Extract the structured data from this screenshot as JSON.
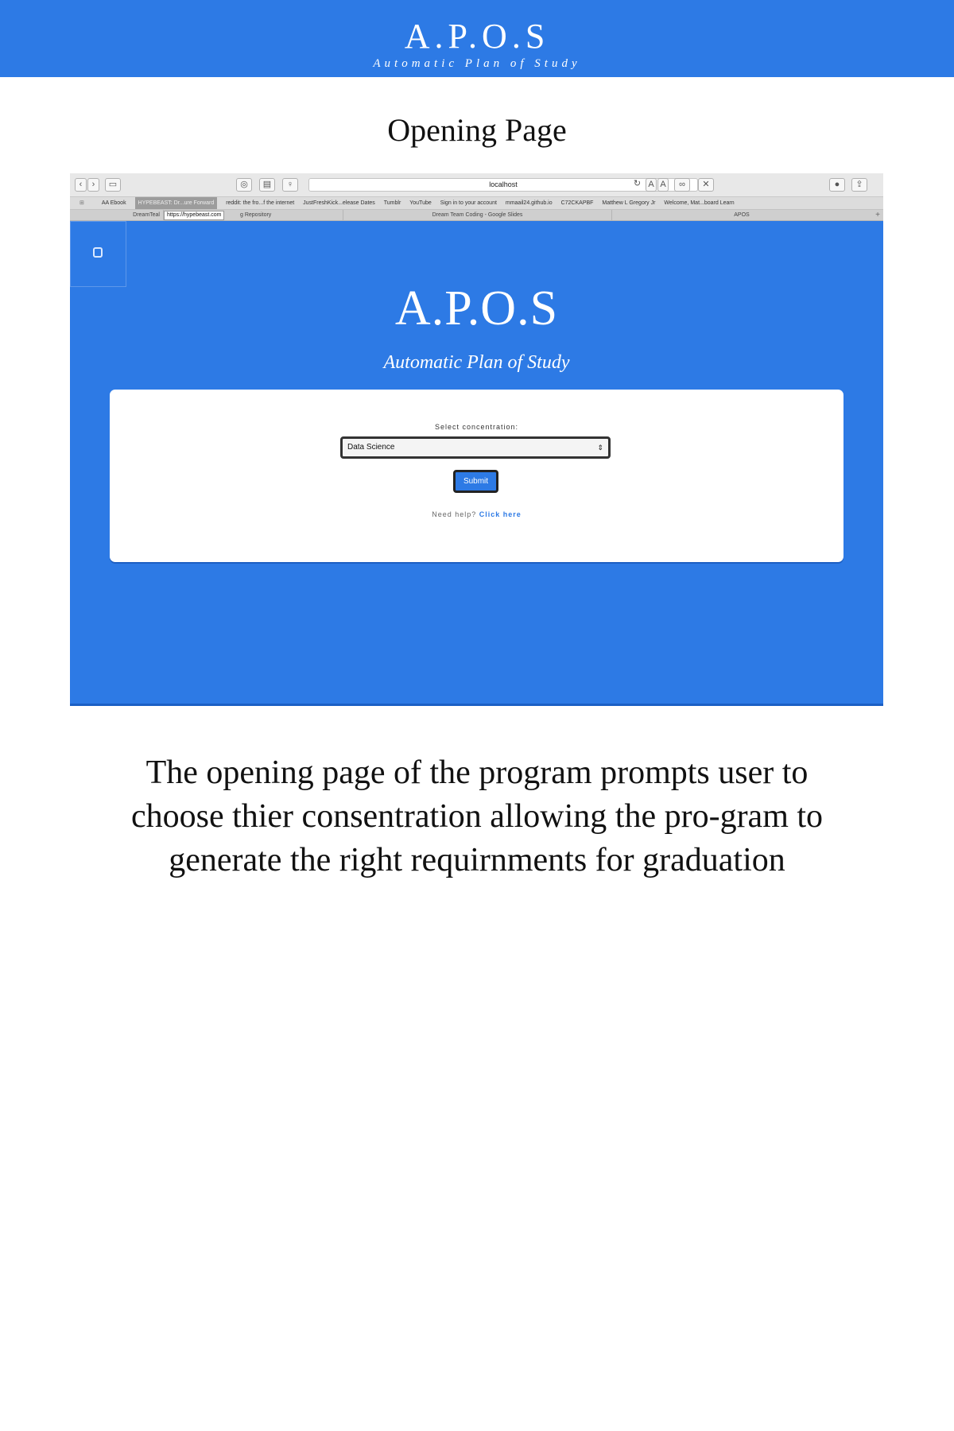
{
  "banner": {
    "title": "A.P.O.S",
    "subtitle": "Automatic Plan of Study"
  },
  "page_heading": "Opening Page",
  "browser": {
    "url": "localhost",
    "bookmarks": [
      "AA Ebook",
      "HYPEBEAST: Dr...ure Forward",
      "reddit: the fro...f the internet",
      "JustFreshKick...elease Dates",
      "Tumblr",
      "YouTube",
      "Sign in to your account",
      "mmaail24.github.io",
      "C72CKAPBF",
      "Matthew L Gregory Jr",
      "Welcome, Mat...board Learn"
    ],
    "tabs": [
      "DreamTeal",
      "g Repository",
      "Dream Team Coding - Google Slides",
      "APOS"
    ],
    "tab_tooltip": "https://hypebeast.com",
    "app_title": "A.P.O.S",
    "app_subtitle": "Automatic Plan of Study",
    "select_label": "Select concentration:",
    "selected_concentration": "Data Science",
    "submit_label": "Submit",
    "help_text": "Need help?",
    "help_link": "Click here"
  },
  "description": "The opening page of the program prompts user to choose thier consentration allowing the pro-gram to generate the right requirnments for graduation"
}
